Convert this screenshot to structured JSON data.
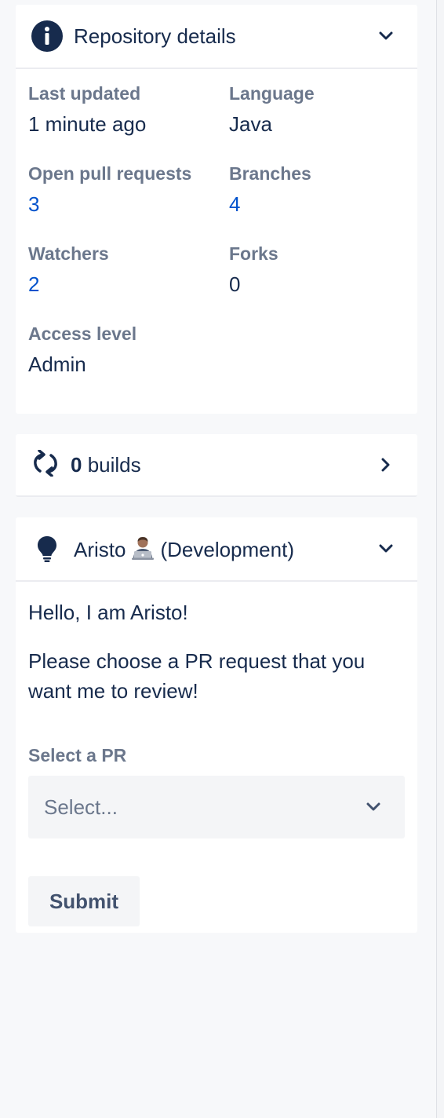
{
  "repo_details": {
    "title": "Repository details",
    "icon": "info-icon",
    "fields": [
      {
        "label": "Last updated",
        "value": "1 minute ago",
        "link": false
      },
      {
        "label": "Language",
        "value": "Java",
        "link": false
      },
      {
        "label": "Open pull requests",
        "value": "3",
        "link": true
      },
      {
        "label": "Branches",
        "value": "4",
        "link": true
      },
      {
        "label": "Watchers",
        "value": "2",
        "link": true
      },
      {
        "label": "Forks",
        "value": "0",
        "link": false
      },
      {
        "label": "Access level",
        "value": "Admin",
        "link": false
      }
    ]
  },
  "builds": {
    "count": "0",
    "label": "builds",
    "icon": "refresh-icon"
  },
  "aristo": {
    "name": "Aristo",
    "emoji": "technologist-emoji",
    "env": "(Development)",
    "icon": "lightbulb-icon",
    "greeting": "Hello, I am Aristo!",
    "prompt": "Please choose a PR request that you want me to review!",
    "select_label": "Select a PR",
    "select_placeholder": "Select...",
    "submit_label": "Submit"
  },
  "colors": {
    "text": "#172b4d",
    "muted": "#6b778c",
    "link": "#0052cc",
    "background": "#f7f8fa"
  }
}
